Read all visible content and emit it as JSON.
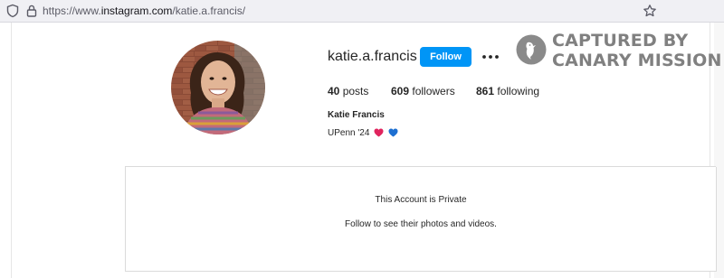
{
  "browser": {
    "url_prefix": "https://www.",
    "url_host": "instagram.com",
    "url_path": "/katie.a.francis/",
    "icons": [
      "shield-icon",
      "lock-icon",
      "bookmark-star-icon"
    ]
  },
  "profile": {
    "username": "katie.a.francis",
    "follow_label": "Follow",
    "more_icon": "more-options-icon",
    "posts_count": "40",
    "posts_label": "posts",
    "followers_count": "609",
    "followers_label": "followers",
    "following_count": "861",
    "following_label": "following",
    "full_name": "Katie Francis",
    "bio_text": "UPenn '24",
    "bio_emojis": [
      "red-heart-icon",
      "blue-heart-icon"
    ]
  },
  "watermark": {
    "line1": "CAPTURED BY",
    "line2": "CANARY MISSION",
    "icon": "canary-bird-icon"
  },
  "private_notice": {
    "title": "This Account is Private",
    "description": "Follow to see their photos and videos."
  },
  "colors": {
    "follow_button": "#0095f6",
    "red_heart": "#e0245e",
    "blue_heart": "#1d6fd1",
    "watermark": "#808080"
  }
}
